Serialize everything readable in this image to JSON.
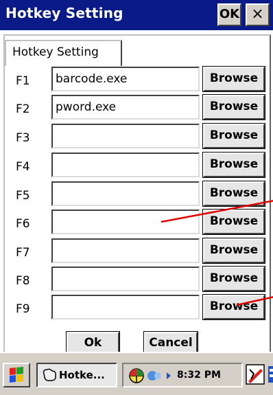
{
  "window": {
    "title": "Hotkey Setting",
    "ok_label": "OK",
    "close_label": "×"
  },
  "tab": {
    "label": "Hotkey Setting"
  },
  "hotkeys": [
    {
      "key": "F1",
      "value": "barcode.exe",
      "browse_label": "Browse"
    },
    {
      "key": "F2",
      "value": "pword.exe",
      "browse_label": "Browse"
    },
    {
      "key": "F3",
      "value": "",
      "browse_label": "Browse"
    },
    {
      "key": "F4",
      "value": "",
      "browse_label": "Browse"
    },
    {
      "key": "F5",
      "value": "",
      "browse_label": "Browse"
    },
    {
      "key": "F6",
      "value": "",
      "browse_label": "Browse"
    },
    {
      "key": "F7",
      "value": "",
      "browse_label": "Browse"
    },
    {
      "key": "F8",
      "value": "",
      "browse_label": "Browse"
    },
    {
      "key": "F9",
      "value": "",
      "browse_label": "Browse"
    }
  ],
  "buttons": {
    "ok_label": "Ok",
    "cancel_label": "Cancel"
  },
  "taskbar": {
    "task_label": "Hotke...",
    "clock": "8:32 PM",
    "start_icon": "windows-flag-icon",
    "task_icon": "app-icon",
    "tray_icons": [
      "color-wheel-icon",
      "network-icon",
      "pen-input-icon",
      "keyboard-icon"
    ]
  },
  "colors": {
    "titlebar": "#0a1a86",
    "annotation_arrow": "#e00000",
    "chrome": "#d4d0c8"
  }
}
